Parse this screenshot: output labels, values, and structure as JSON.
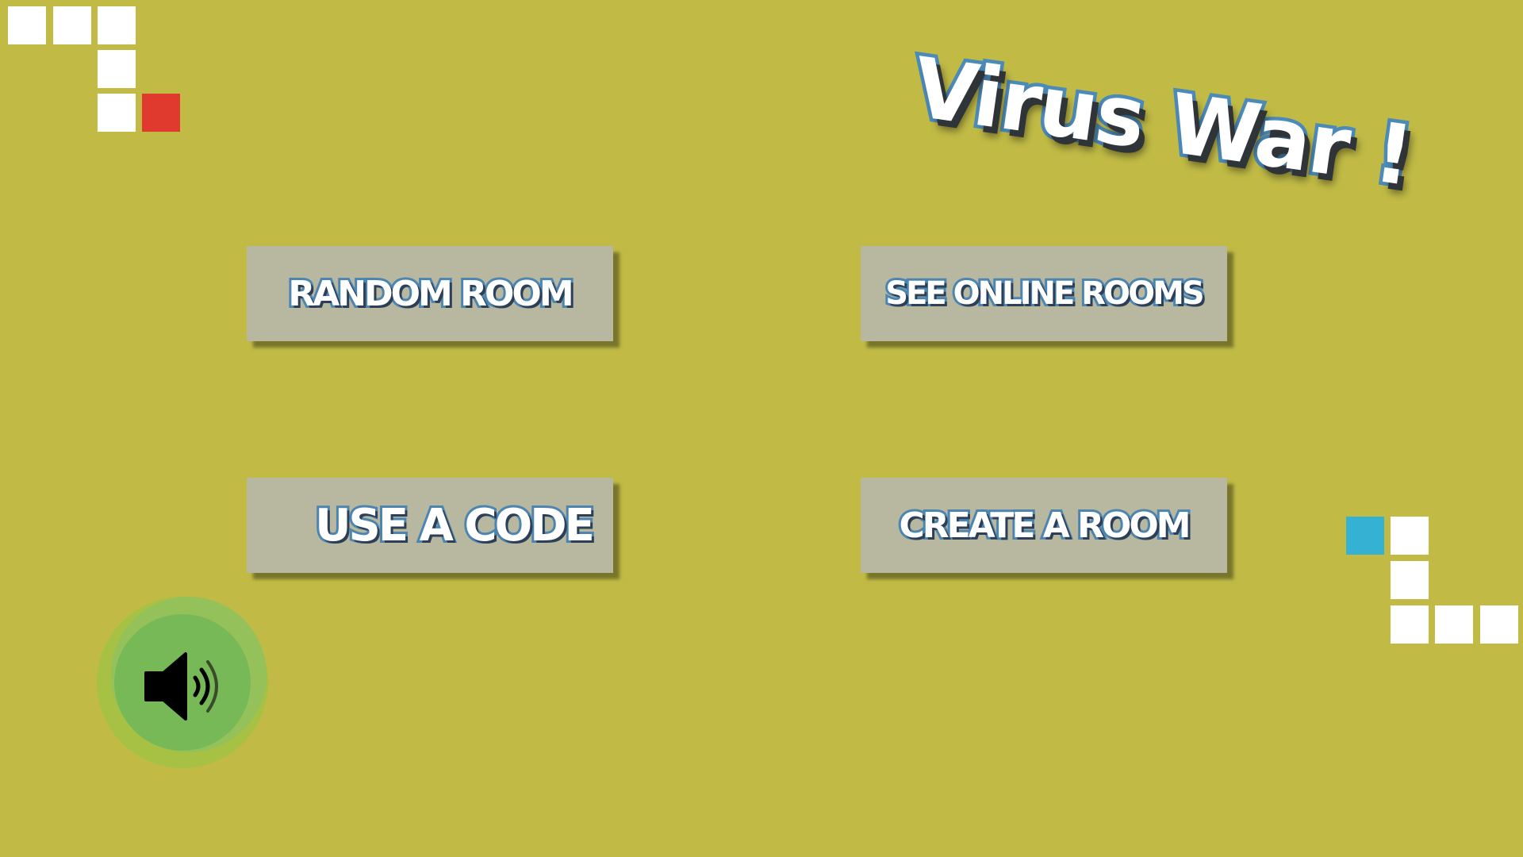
{
  "title": "Virus War !",
  "buttons": {
    "random_room": "RANDOM ROOM",
    "see_online_rooms": "SEE ONLINE ROOMS",
    "use_a_code": "USE A CODE",
    "create_a_room": "CREATE A ROOM"
  },
  "sound": {
    "icon": "speaker-volume-icon"
  },
  "colors": {
    "background": "#c1bb46",
    "button": "#b8b79f",
    "text_outline": "#4c85b0",
    "red_cell": "#e03a2f",
    "blue_cell": "#35b1d3",
    "sound_button": "#77b956"
  }
}
